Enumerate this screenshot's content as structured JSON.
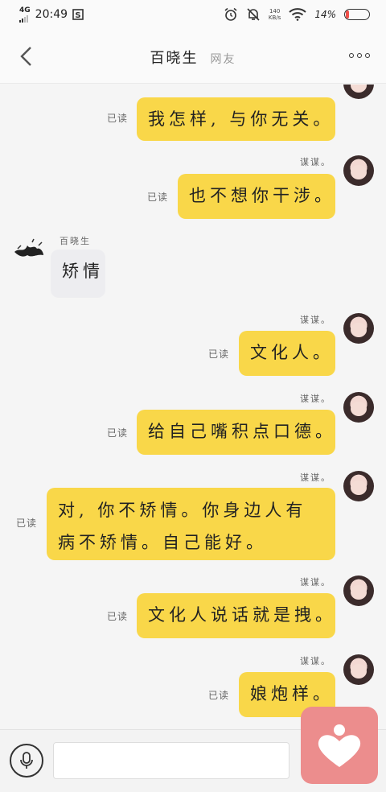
{
  "status_bar": {
    "network": "4G",
    "time": "20:49",
    "speed_value": "140",
    "speed_unit": "KB/s",
    "battery_percent": "14%",
    "battery_level": 0.14
  },
  "header": {
    "title": "百晓生",
    "subtitle": "网友"
  },
  "messages": [
    {
      "text": "我怎样, 与你无关。",
      "sender": "",
      "read": "已读"
    },
    {
      "text": "也不想你干涉。",
      "sender": "谋谋。",
      "read": "已读"
    },
    {
      "text": "矫情",
      "sender": "百晓生",
      "read": ""
    },
    {
      "text": "文化人。",
      "sender": "谋谋。",
      "read": "已读"
    },
    {
      "text": "给自己嘴积点口德。",
      "sender": "谋谋。",
      "read": "已读"
    },
    {
      "text": "对, 你不矫情。你身边人有病不矫情。自己能好。",
      "sender": "谋谋。",
      "read": "已读"
    },
    {
      "text": "文化人说话就是拽。",
      "sender": "谋谋。",
      "read": "已读"
    },
    {
      "text": "娘炮样。",
      "sender": "谋谋。",
      "read": "已读"
    }
  ],
  "input": {
    "placeholder": ""
  },
  "icons": {
    "back": "chevron-left-icon",
    "more": "more-icon",
    "mic": "microphone-icon",
    "gift": "heart-gift-icon"
  },
  "colors": {
    "bubble_self": "#f9d749",
    "bubble_other": "#ededf0",
    "gift": "#ec8d8d"
  }
}
